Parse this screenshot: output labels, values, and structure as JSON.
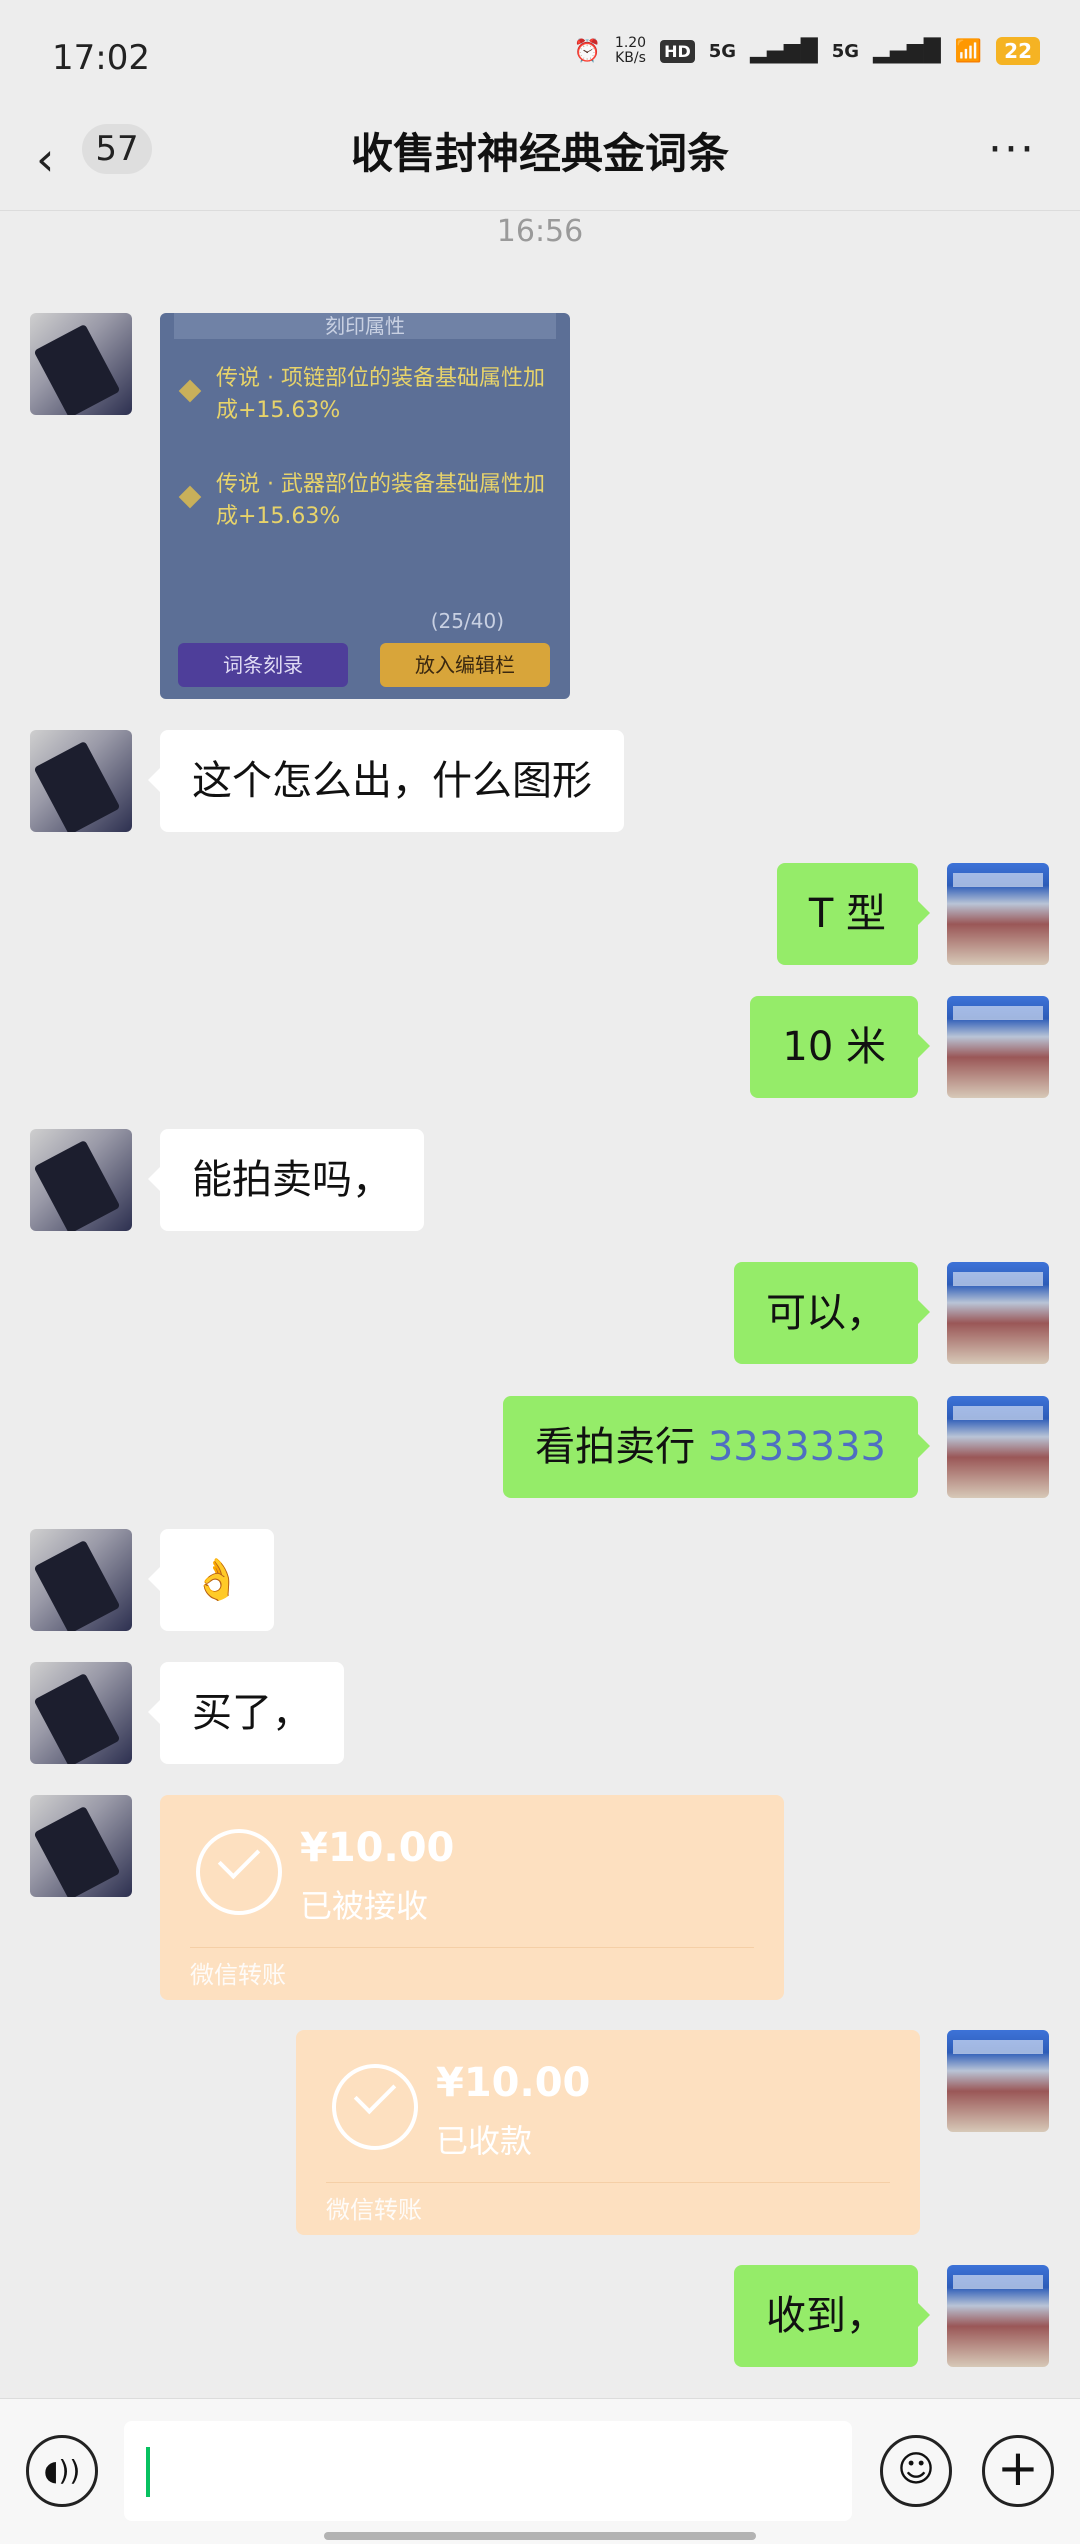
{
  "status_bar": {
    "time": "17:02",
    "speed": "1.20",
    "speed_unit": "KB/s",
    "hd": "HD",
    "signal1": "5G",
    "signal2": "5G",
    "battery": "22"
  },
  "header": {
    "back_count": "57",
    "title": "收售封神经典金词条",
    "more": "···"
  },
  "timestamp": "16:56",
  "image_message": {
    "header": "刻印属性",
    "line1": "传说 · 项链部位的装备基础属性加成+15.63%",
    "line2": "传说 · 武器部位的装备基础属性加成+15.63%",
    "counter": "(25/40)",
    "btn1": "词条刻录",
    "btn2": "放入编辑栏"
  },
  "messages": [
    {
      "side": "left",
      "text": "这个怎么出，什么图形"
    },
    {
      "side": "right",
      "text": "T 型"
    },
    {
      "side": "right",
      "text": "10 米"
    },
    {
      "side": "left",
      "text": "能拍卖吗，"
    },
    {
      "side": "right",
      "text": "可以，"
    },
    {
      "side": "right",
      "text_prefix": "看拍卖行 ",
      "text_number": "3333333"
    },
    {
      "side": "left",
      "text": "👌"
    },
    {
      "side": "left",
      "text": "买了，"
    },
    {
      "side": "right",
      "text": "收到，"
    }
  ],
  "transfers": [
    {
      "side": "left",
      "amount": "¥10.00",
      "status": "已被接收",
      "footer": "微信转账"
    },
    {
      "side": "right",
      "amount": "¥10.00",
      "status": "已收款",
      "footer": "微信转账"
    }
  ],
  "input_bar": {
    "voice_icon": "voice-icon",
    "emoji_icon": "emoji-icon",
    "plus_icon": "plus-icon",
    "input_value": ""
  }
}
